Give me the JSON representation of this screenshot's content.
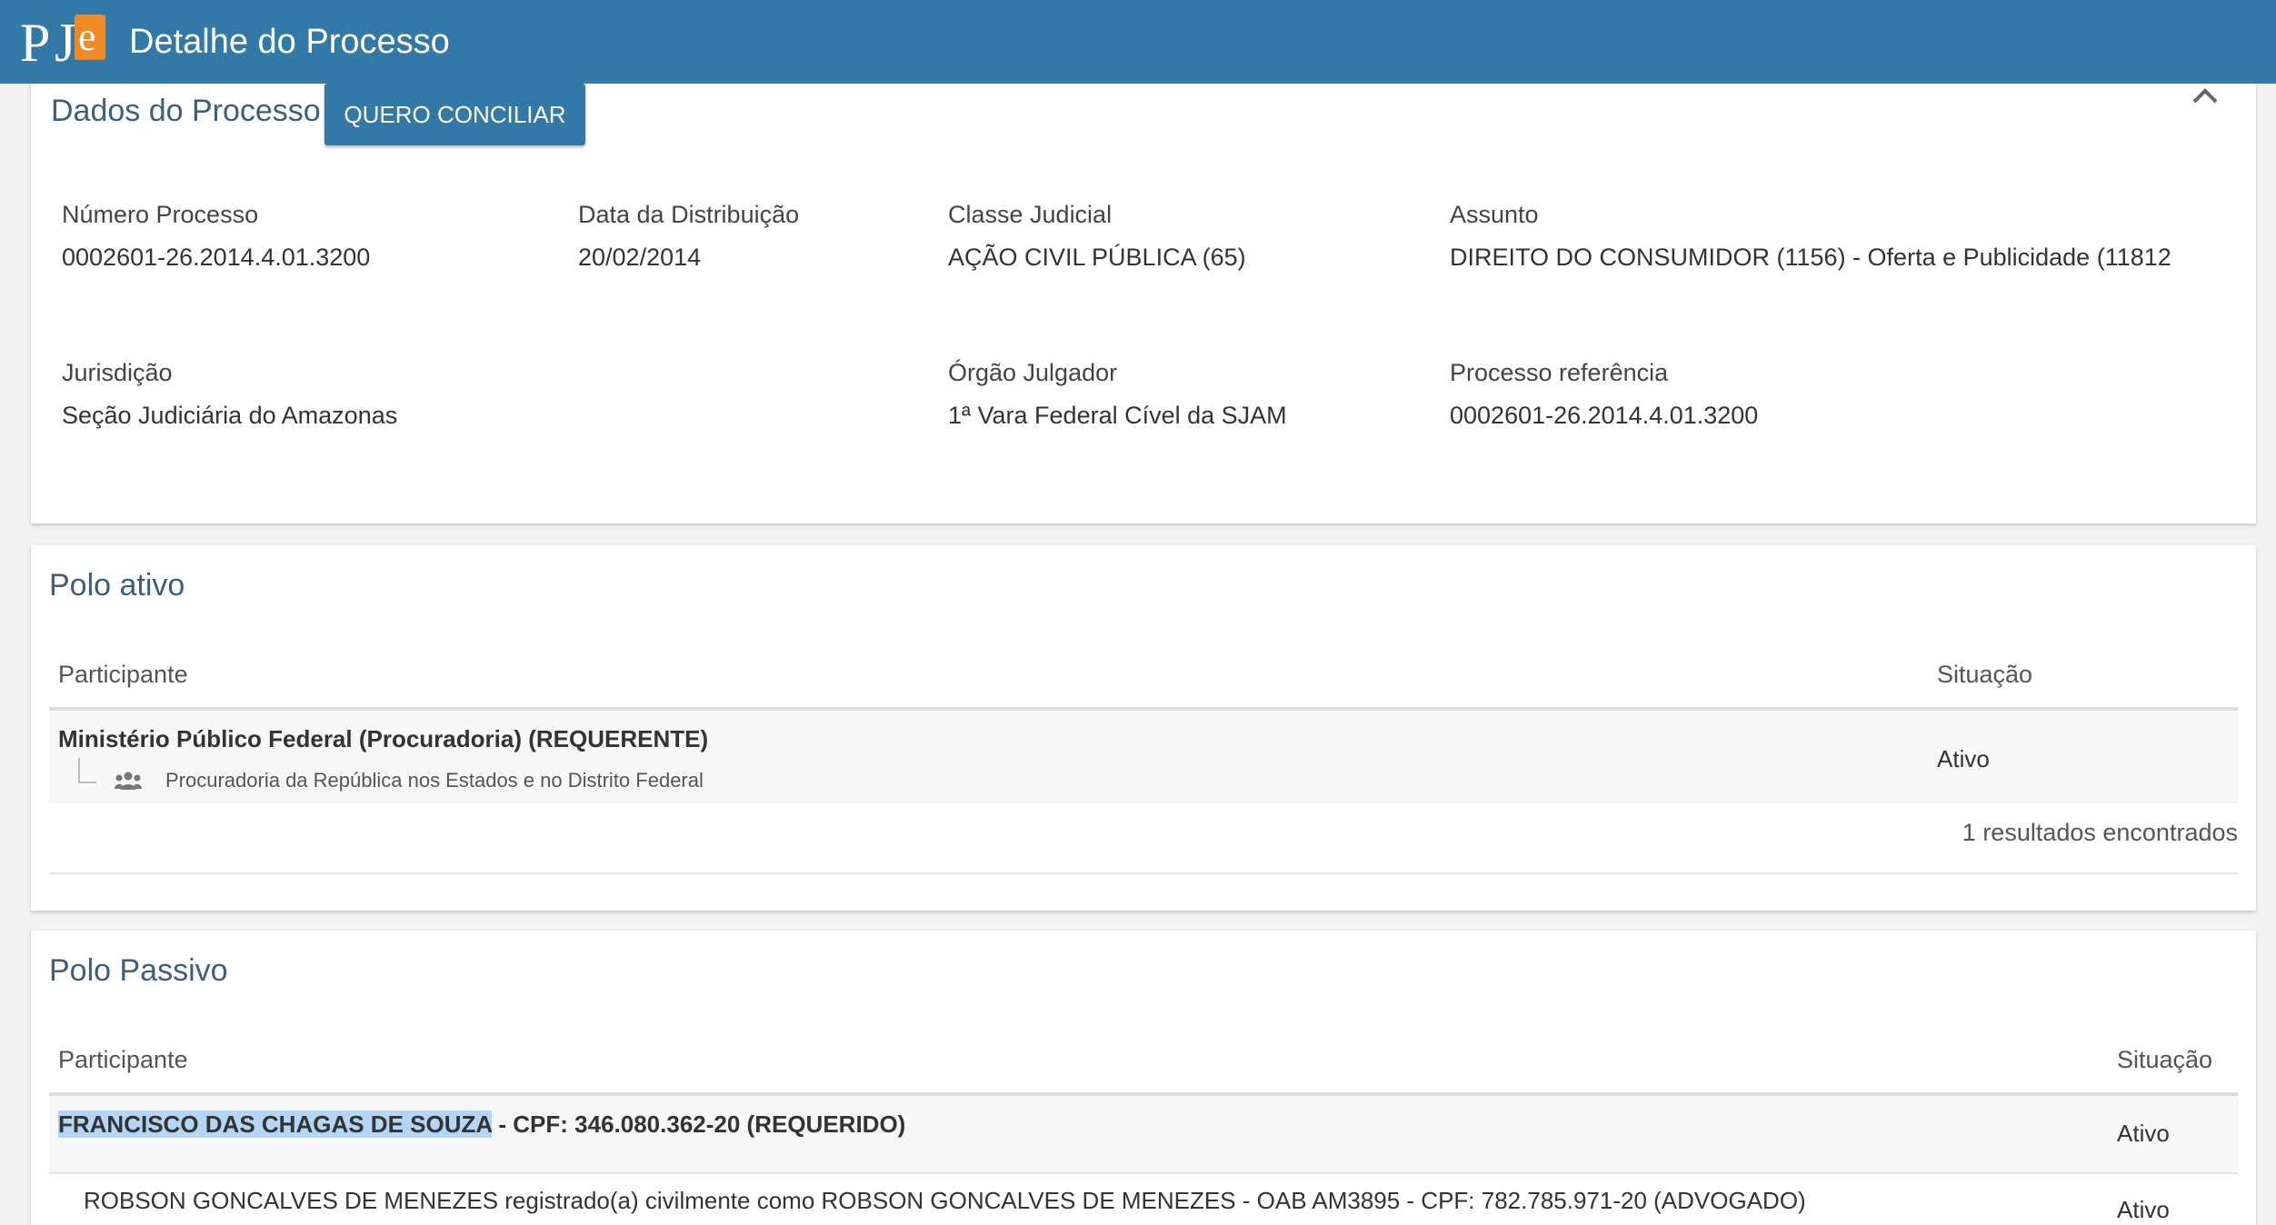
{
  "header": {
    "logo_text": "PJe",
    "title": "Detalhe do Processo"
  },
  "dados": {
    "title": "Dados do Processo",
    "conciliar_label": "QUERO CONCILIAR",
    "fields": {
      "numero_label": "Número Processo",
      "numero_value": "0002601-26.2014.4.01.3200",
      "data_label": "Data da Distribuição",
      "data_value": "20/02/2014",
      "classe_label": "Classe Judicial",
      "classe_value": "AÇÃO CIVIL PÚBLICA (65)",
      "assunto_label": "Assunto",
      "assunto_value": "DIREITO DO CONSUMIDOR (1156) - Oferta e Publicidade (11812",
      "jurisdicao_label": "Jurisdição",
      "jurisdicao_value": "Seção Judiciária do Amazonas",
      "orgao_label": "Órgão Julgador",
      "orgao_value": "1ª Vara Federal Cível da SJAM",
      "referencia_label": "Processo referência",
      "referencia_value": "0002601-26.2014.4.01.3200"
    }
  },
  "polo_ativo": {
    "title": "Polo ativo",
    "col_participante": "Participante",
    "col_situacao": "Situação",
    "rows": [
      {
        "name": "Ministério Público Federal (Procuradoria) (REQUERENTE)",
        "sub": "Procuradoria da República nos Estados e no Distrito Federal",
        "status": "Ativo"
      }
    ],
    "results": "1 resultados encontrados"
  },
  "polo_passivo": {
    "title": "Polo Passivo",
    "col_participante": "Participante",
    "col_situacao": "Situação",
    "rows": [
      {
        "name_highlight": "FRANCISCO DAS CHAGAS DE SOUZA",
        "name_rest": " - CPF: 346.080.362-20 (REQUERIDO)",
        "status": "Ativo"
      },
      {
        "name": "ROBSON GONCALVES DE MENEZES registrado(a) civilmente como ROBSON GONCALVES DE MENEZES - OAB AM3895 - CPF: 782.785.971-20 (ADVOGADO)",
        "status": "Ativo"
      }
    ]
  },
  "icons": {
    "group": "group-icon",
    "collapse": "chevron-up-icon"
  },
  "colors": {
    "brand": "#3279a8",
    "logo_accent": "#f08a24",
    "title_text": "#3d5f7e",
    "highlight": "#b5d5f5"
  }
}
